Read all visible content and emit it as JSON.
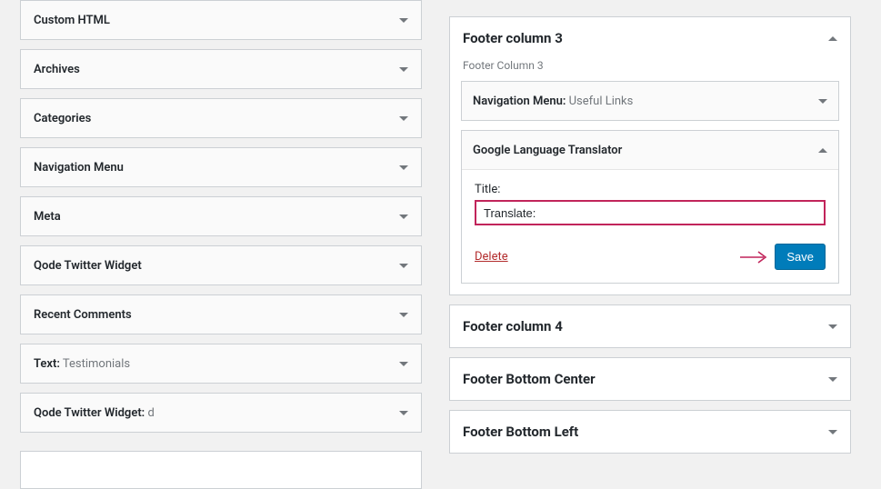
{
  "left": {
    "widgets": [
      {
        "title": "Custom HTML",
        "suffix": ""
      },
      {
        "title": "Archives",
        "suffix": ""
      },
      {
        "title": "Categories",
        "suffix": ""
      },
      {
        "title": "Navigation Menu",
        "suffix": ""
      },
      {
        "title": "Meta",
        "suffix": ""
      },
      {
        "title": "Qode Twitter Widget",
        "suffix": ""
      },
      {
        "title": "Recent Comments",
        "suffix": ""
      },
      {
        "title": "Text:",
        "suffix": " Testimonials"
      },
      {
        "title": "Qode Twitter Widget:",
        "suffix": " d"
      }
    ]
  },
  "right": {
    "footer3": {
      "title": "Footer column 3",
      "desc": "Footer Column 3",
      "nav": {
        "title": "Navigation Menu:",
        "suffix": " Useful Links"
      },
      "translator": {
        "title": "Google Language Translator",
        "field_label": "Title:",
        "field_value": "Translate:",
        "delete": "Delete",
        "save": "Save"
      }
    },
    "footer4": {
      "title": "Footer column 4"
    },
    "fbc": {
      "title": "Footer Bottom Center"
    },
    "fbl": {
      "title": "Footer Bottom Left"
    }
  }
}
